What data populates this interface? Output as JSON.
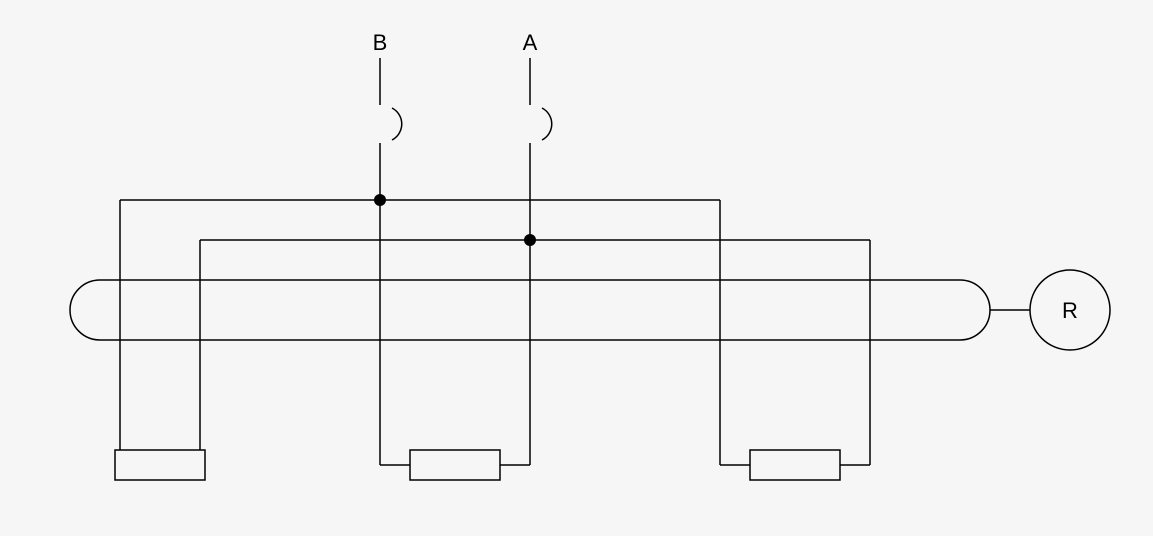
{
  "labels": {
    "A": "A",
    "B": "B",
    "R": "R"
  },
  "components": {
    "switches": [
      "switch-A",
      "switch-B"
    ],
    "resistor_blocks": 3,
    "motor_or_meter": "R",
    "stadium_bus": true
  }
}
